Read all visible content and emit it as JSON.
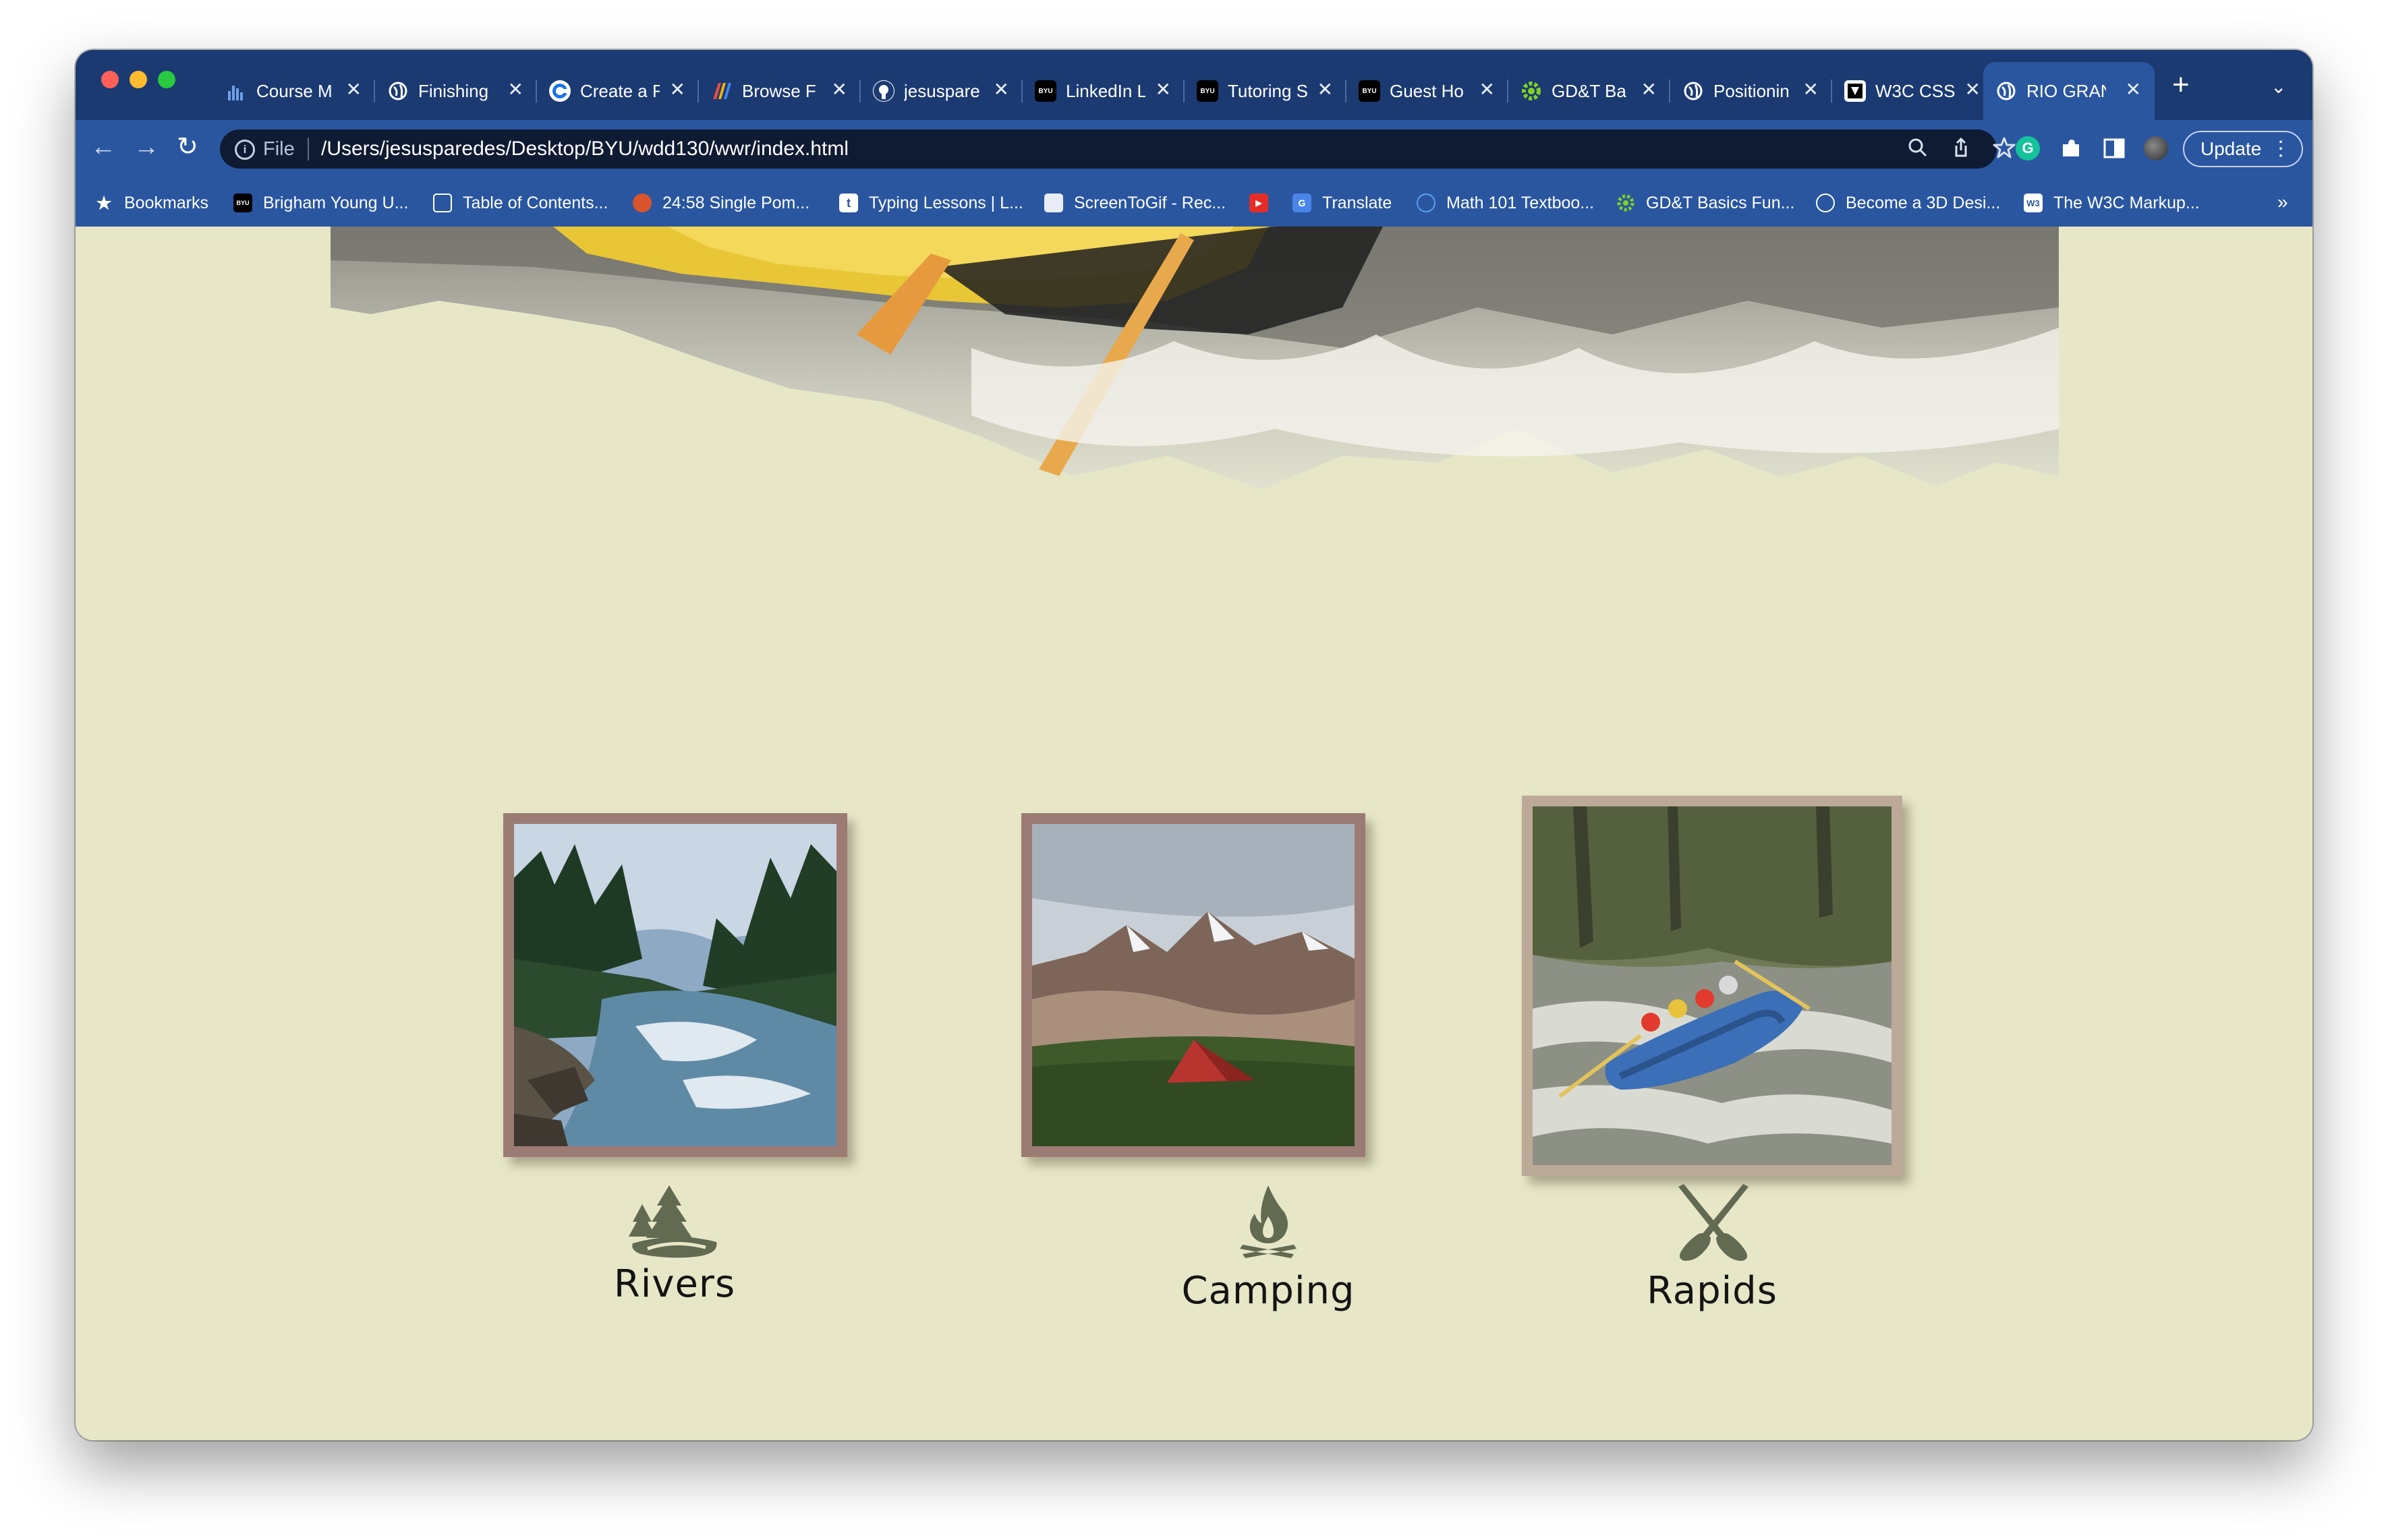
{
  "browser": {
    "tabs": [
      {
        "title": "Course M",
        "icon": "canvas-bars-icon",
        "active": false
      },
      {
        "title": "Finishing",
        "icon": "globe-icon",
        "active": false
      },
      {
        "title": "Create a F",
        "icon": "chrome-c-icon",
        "active": false
      },
      {
        "title": "Browse F",
        "icon": "colorful-logo-icon",
        "active": false
      },
      {
        "title": "jesuspare",
        "icon": "github-icon",
        "active": false
      },
      {
        "title": "LinkedIn L",
        "icon": "byu-icon",
        "active": false
      },
      {
        "title": "Tutoring S",
        "icon": "byu-icon",
        "active": false
      },
      {
        "title": "Guest Ho",
        "icon": "byu-icon",
        "active": false
      },
      {
        "title": "GD&T Ba",
        "icon": "gear-green-icon",
        "active": false
      },
      {
        "title": "Positionin",
        "icon": "globe-icon",
        "active": false
      },
      {
        "title": "W3C CSS",
        "icon": "w3c-icon",
        "active": false
      },
      {
        "title": "RIO GRAN",
        "icon": "globe-icon",
        "active": true
      }
    ],
    "toolbar": {
      "scheme": "File",
      "url": "/Users/jesusparedes/Desktop/BYU/wdd130/wwr/index.html",
      "update_label": "Update"
    },
    "bookmarks": [
      {
        "label": "Bookmarks",
        "icon": "star-icon"
      },
      {
        "label": "Brigham Young U...",
        "icon": "byu-icon"
      },
      {
        "label": "Table of Contents...",
        "icon": "document-icon"
      },
      {
        "label": "24:58 Single Pom...",
        "icon": "tomato-icon"
      },
      {
        "label": "Typing Lessons | L...",
        "icon": "typing-icon"
      },
      {
        "label": "ScreenToGif - Rec...",
        "icon": "screen-icon"
      },
      {
        "label": "",
        "icon": "youtube-icon"
      },
      {
        "label": "Translate",
        "icon": "translate-icon"
      },
      {
        "label": "Math 101 Textboo...",
        "icon": "math-icon"
      },
      {
        "label": "GD&T Basics Fun...",
        "icon": "gear-green-icon"
      },
      {
        "label": "Become a 3D Desi...",
        "icon": "globe-icon"
      },
      {
        "label": "The W3C Markup...",
        "icon": "w3c-icon"
      }
    ],
    "colors": {
      "tabstrip": "#1c3a72",
      "toolbar": "#2a56a0",
      "page_background": "#e7e7c8"
    }
  },
  "page": {
    "cards": [
      {
        "label": "Rivers",
        "icon": "forest-river-icon",
        "photo": "mountain-river-photo"
      },
      {
        "label": "Camping",
        "icon": "campfire-icon",
        "photo": "mountain-tent-photo"
      },
      {
        "label": "Rapids",
        "icon": "crossed-paddles-icon",
        "photo": "rafting-photo"
      }
    ]
  }
}
